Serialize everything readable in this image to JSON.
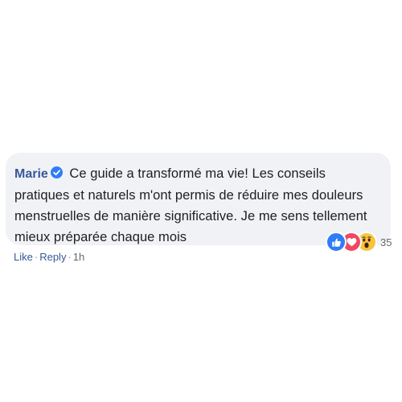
{
  "comment": {
    "author": "Marie",
    "text": "Ce guide a transformé ma vie! Les conseils pratiques et naturels m'ont permis de réduire mes douleurs menstruelles de manière significative. Je me sens tellement mieux préparée chaque mois"
  },
  "reactions": {
    "icons": [
      "like-icon",
      "love-icon",
      "wow-icon"
    ],
    "count": "35"
  },
  "actions": {
    "like_label": "Like",
    "separator": "·",
    "reply_label": "Reply",
    "time": "1h"
  },
  "colors": {
    "author": "#385898",
    "bubble": "#f1f2f6",
    "verified": "#2f7cf6",
    "like": "#2f7cf6",
    "love": "#f0475f",
    "wow": "#f9c33c"
  }
}
